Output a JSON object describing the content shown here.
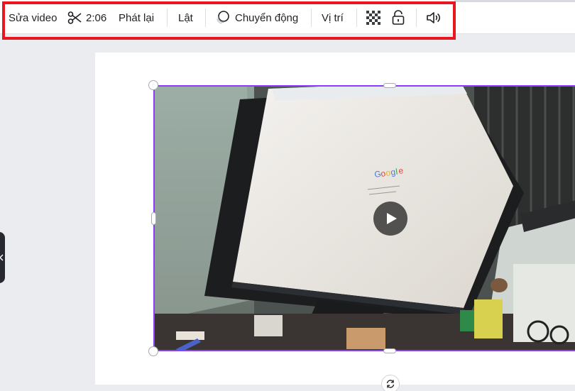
{
  "toolbar": {
    "edit_video_label": "Sửa video",
    "trim_duration": "2:06",
    "playback_label": "Phát lại",
    "flip_label": "Lật",
    "animate_label": "Chuyển động",
    "position_label": "Vị trí",
    "transparency_icon": "transparency-checker-icon",
    "lock_icon": "lock-icon",
    "volume_icon": "speaker-icon",
    "trim_icon": "scissors-icon",
    "animate_icon": "animate-circles-icon"
  },
  "video": {
    "play_icon": "play-icon",
    "selection_color": "#8b3dff"
  },
  "canvas": {
    "rotate_icon": "rotate-icon"
  },
  "side_panel": {
    "toggle_icon": "chevron-left-icon"
  },
  "colors": {
    "highlight": "#e8161e",
    "selection": "#8b3dff",
    "workspace": "#ebecf0"
  }
}
